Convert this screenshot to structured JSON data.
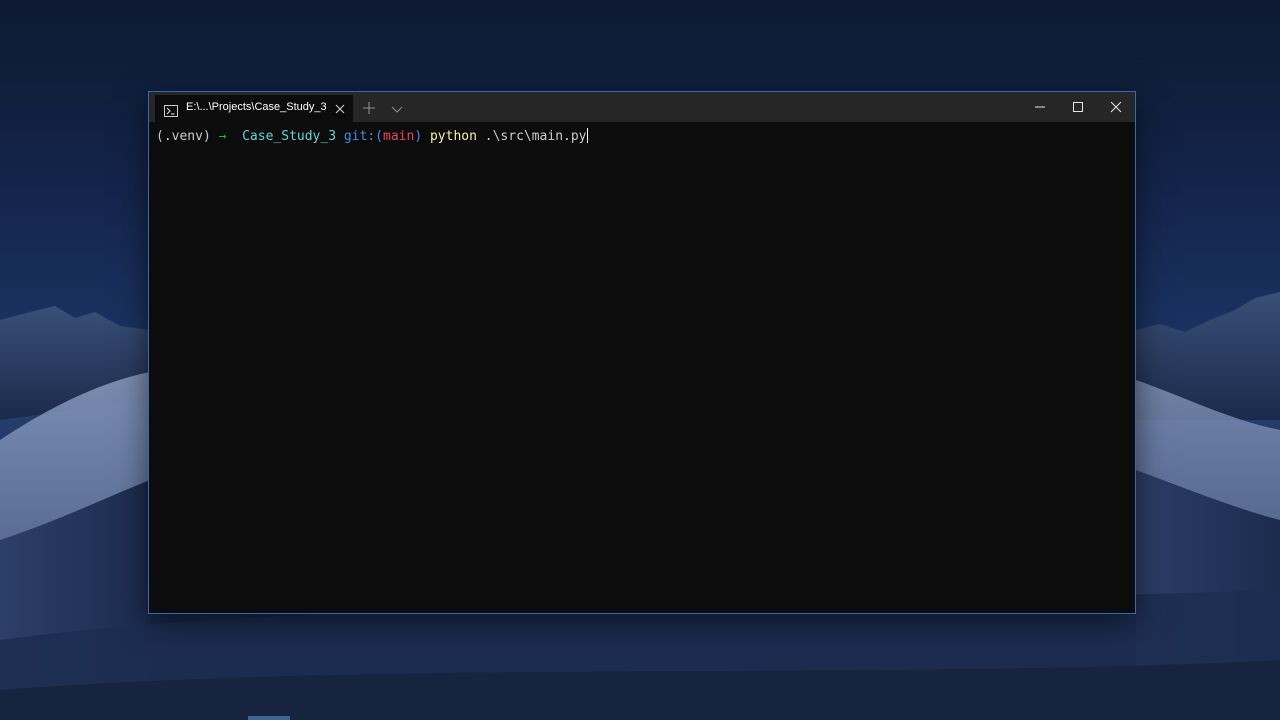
{
  "desktop": {
    "wallpaper": "mojave-night-dunes"
  },
  "window": {
    "tab_title": "E:\\...\\Projects\\Case_Study_3",
    "tab_icon": "powershell-icon",
    "controls": {
      "minimize": "minimize-icon",
      "maximize": "maximize-icon",
      "close": "close-icon"
    }
  },
  "terminal": {
    "venv": "(.venv)",
    "arrow": "→",
    "directory": "Case_Study_3",
    "git_prefix": "git:(",
    "branch": "main",
    "git_suffix": ")",
    "command": "python",
    "args": ".\\src\\main.py"
  },
  "colors": {
    "window_border": "#2a6fb4",
    "terminal_bg": "#0c0c0c",
    "titlebar_bg": "#262626",
    "arrow": "#16c60c",
    "directory": "#61d6d6",
    "git": "#3b8eea",
    "branch": "#e74856",
    "command": "#f9f1a5"
  }
}
